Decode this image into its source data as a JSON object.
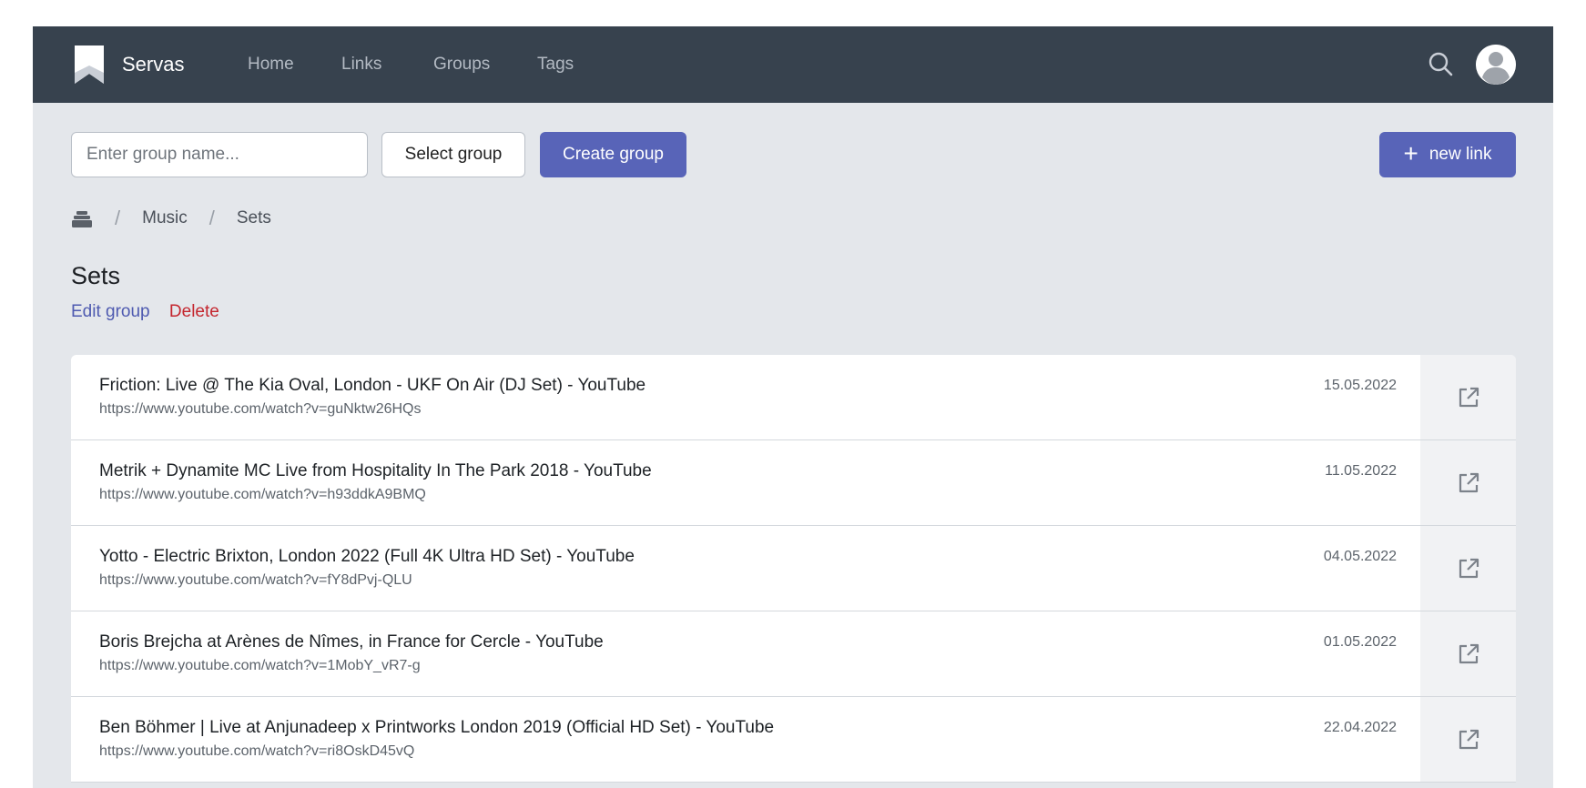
{
  "navbar": {
    "brand": "Servas",
    "items": [
      {
        "label": "Home"
      },
      {
        "label": "Links"
      },
      {
        "label": "Groups"
      },
      {
        "label": "Tags"
      }
    ],
    "icons": {
      "logo": "bookmark-icon",
      "search": "search-icon",
      "avatar": "user-avatar-icon"
    }
  },
  "toolbar": {
    "group_input_placeholder": "Enter group name...",
    "group_input_value": "",
    "select_group_label": "Select group",
    "create_group_label": "Create group",
    "new_link_label": "new link"
  },
  "breadcrumb": {
    "home_icon": "groups-home-icon",
    "items": [
      "Music",
      "Sets"
    ]
  },
  "group": {
    "title": "Sets",
    "edit_label": "Edit group",
    "delete_label": "Delete"
  },
  "links": [
    {
      "title": "Friction: Live @ The Kia Oval, London - UKF On Air (DJ Set) - YouTube",
      "url": "https://www.youtube.com/watch?v=guNktw26HQs",
      "date": "15.05.2022"
    },
    {
      "title": "Metrik + Dynamite MC Live from Hospitality In The Park 2018 - YouTube",
      "url": "https://www.youtube.com/watch?v=h93ddkA9BMQ",
      "date": "11.05.2022"
    },
    {
      "title": "Yotto - Electric Brixton, London 2022 (Full 4K Ultra HD Set) - YouTube",
      "url": "https://www.youtube.com/watch?v=fY8dPvj-QLU",
      "date": "04.05.2022"
    },
    {
      "title": "Boris Brejcha at Arènes de Nîmes, in France for Cercle - YouTube",
      "url": "https://www.youtube.com/watch?v=1MobY_vR7-g",
      "date": "01.05.2022"
    },
    {
      "title": "Ben Böhmer | Live at Anjunadeep x Printworks London 2019 (Official HD Set) - YouTube",
      "url": "https://www.youtube.com/watch?v=ri8OskD45vQ",
      "date": "22.04.2022"
    }
  ],
  "colors": {
    "navbar_bg": "#37424e",
    "page_bg": "#e4e7eb",
    "primary": "#5864b8",
    "edit_link": "#4e5ab0",
    "delete_link": "#c4262e"
  }
}
